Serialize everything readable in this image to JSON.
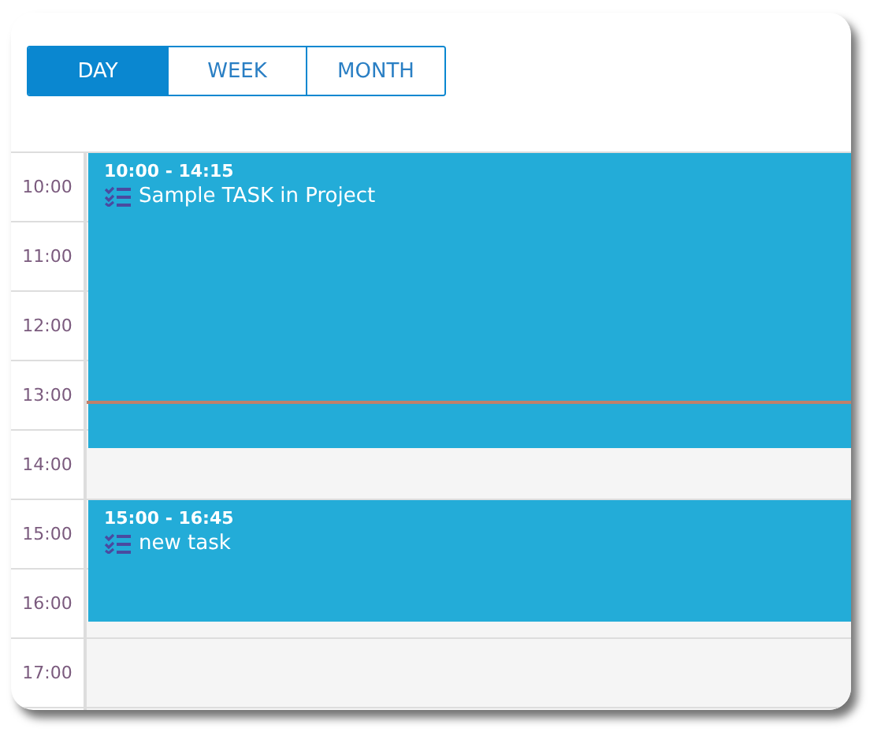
{
  "view_tabs": [
    {
      "label": "DAY",
      "selected": true
    },
    {
      "label": "WEEK",
      "selected": false
    },
    {
      "label": "MONTH",
      "selected": false
    }
  ],
  "hours": [
    "10:00",
    "11:00",
    "12:00",
    "13:00",
    "14:00",
    "15:00",
    "16:00",
    "17:00"
  ],
  "events": [
    {
      "time": "10:00 - 14:15",
      "title": "Sample TASK in Project"
    },
    {
      "time": "15:00 - 16:45",
      "title": "new task"
    }
  ]
}
